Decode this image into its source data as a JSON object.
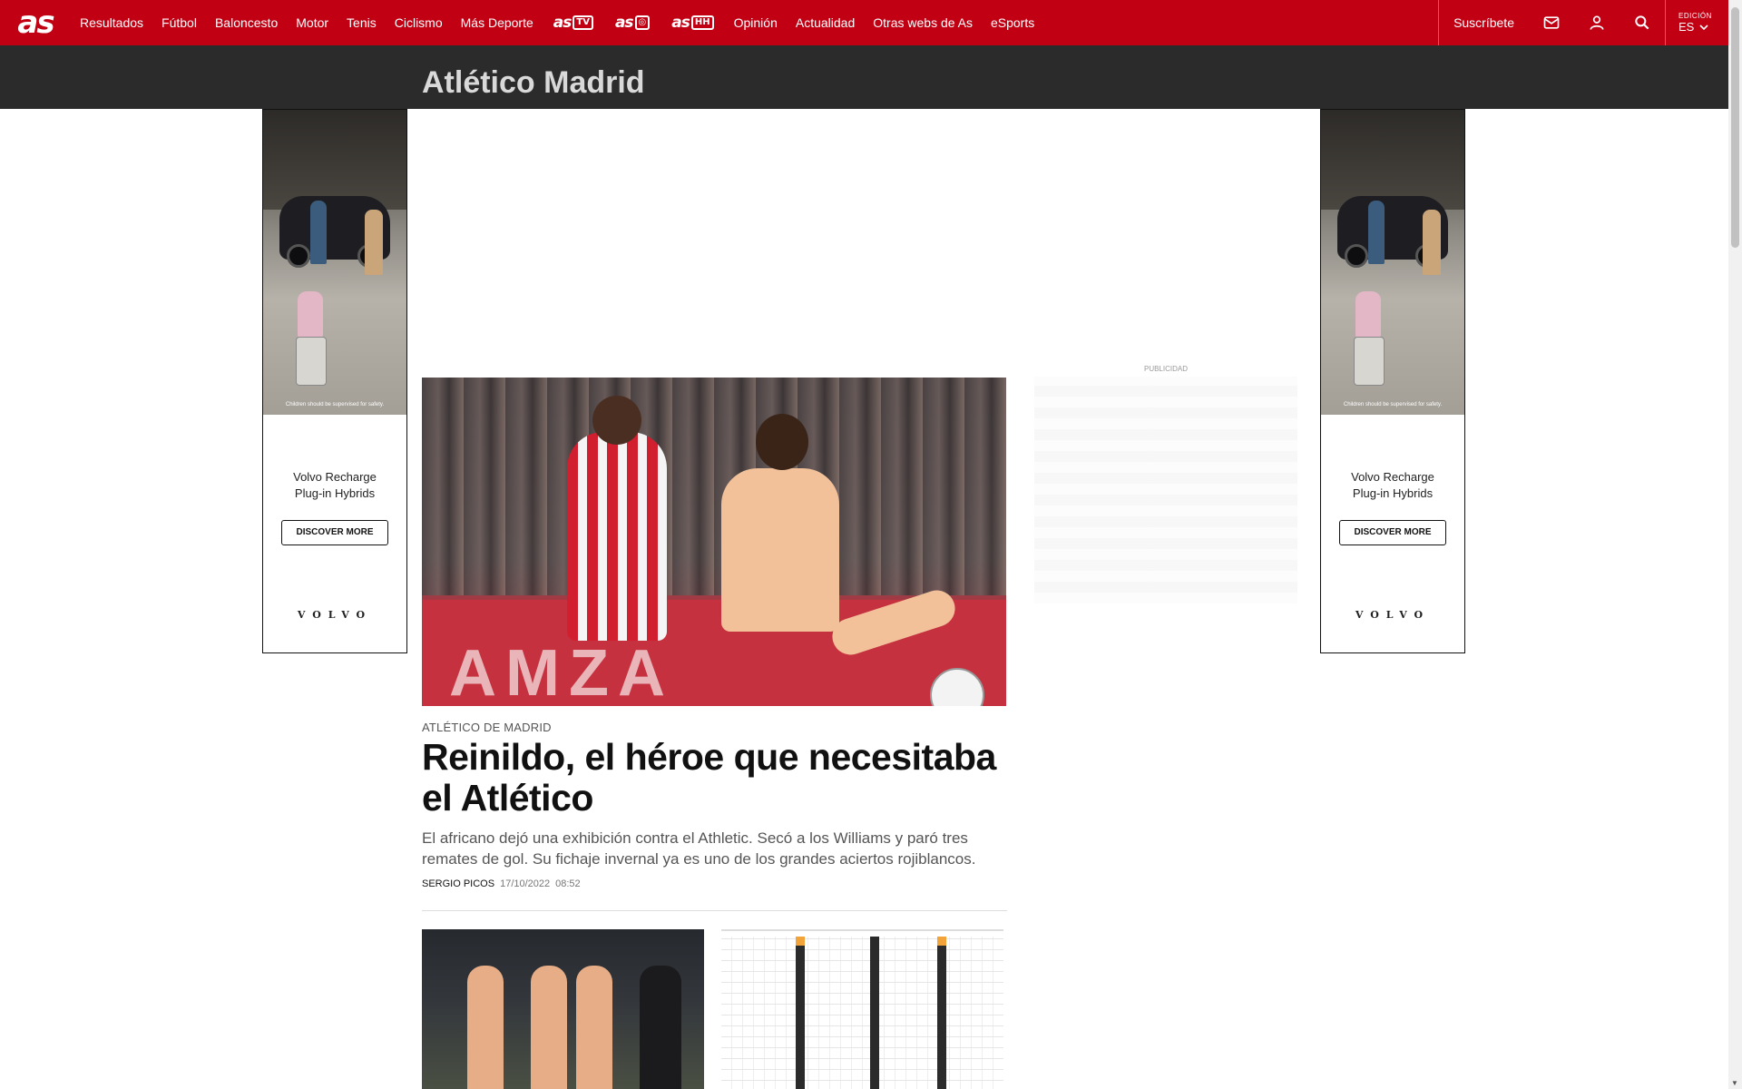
{
  "nav": {
    "logo": "as",
    "items": [
      "Resultados",
      "Fútbol",
      "Baloncesto",
      "Motor",
      "Tenis",
      "Ciclismo",
      "Más Deporte"
    ],
    "brands": [
      {
        "name": "as",
        "suffix": "TV"
      },
      {
        "name": "as",
        "suffix": "◎"
      },
      {
        "name": "as",
        "suffix": "HH"
      }
    ],
    "items2": [
      "Opinión",
      "Actualidad",
      "Otras webs de As",
      "eSports"
    ],
    "subscribe": "Suscríbete",
    "edition_label": "EDICIÓN",
    "edition_value": "ES"
  },
  "section": {
    "title": "Atlético Madrid"
  },
  "ads": {
    "disclaimer": "Children should be supervised for safety.",
    "text_line1": "Volvo Recharge",
    "text_line2": "Plug-in Hybrids",
    "button": "DISCOVER MORE",
    "brand": "VOLVO",
    "publicidad": "PUBLICIDAD"
  },
  "article": {
    "kicker": "ATLÉTICO DE MADRID",
    "headline": "Reinildo, el héroe que necesitaba el Atlético",
    "summary": "El africano dejó una exhibición contra el Athletic. Secó a los Williams y paró tres remates de gol. Su fichaje invernal ya es uno de los grandes aciertos rojiblancos.",
    "author": "SERGIO PICOS",
    "date": "17/10/2022",
    "time": "08:52",
    "image_board_text": "AMZA"
  },
  "colors": {
    "brand_red": "#c10014",
    "section_bg": "#2b2b2b"
  }
}
